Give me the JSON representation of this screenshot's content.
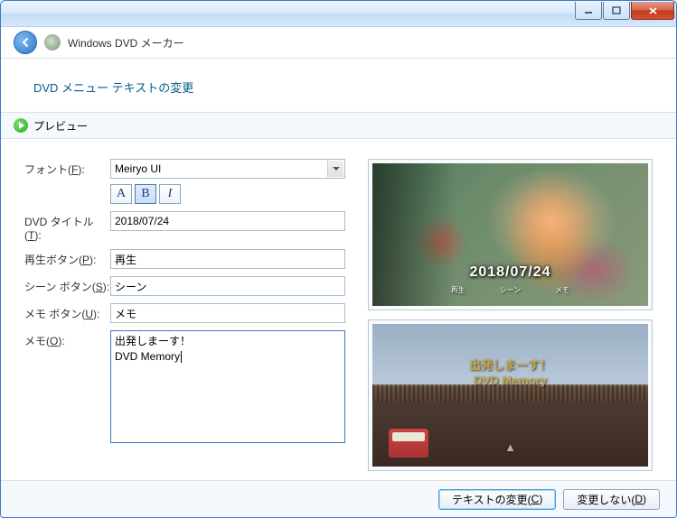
{
  "window": {
    "app_title": "Windows DVD メーカー",
    "subheader": "DVD メニュー テキストの変更",
    "preview_label": "プレビュー"
  },
  "form": {
    "font_label": "フォント(F):",
    "font_value": "Meiryo UI",
    "fmt_color": "A",
    "fmt_bold": "B",
    "fmt_italic": "I",
    "title_label": "DVD タイトル(T):",
    "title_value": "2018/07/24",
    "play_label": "再生ボタン(P):",
    "play_value": "再生",
    "scene_label": "シーン ボタン(S):",
    "scene_value": "シーン",
    "notes_btn_label": "メモ ボタン(U):",
    "notes_btn_value": "メモ",
    "notes_label": "メモ(O):",
    "notes_value": "出発しまーす！\nDVD Memory"
  },
  "preview1": {
    "date": "2018/07/24",
    "btn_play": "再生",
    "btn_scene": "シーン",
    "btn_memo": "メモ"
  },
  "preview2": {
    "line1": "出発しまーす！",
    "line2": "DVD Memory",
    "arrow": "▲"
  },
  "footer": {
    "change_text": "テキストの変更(C)",
    "no_change": "変更しない(D)"
  }
}
